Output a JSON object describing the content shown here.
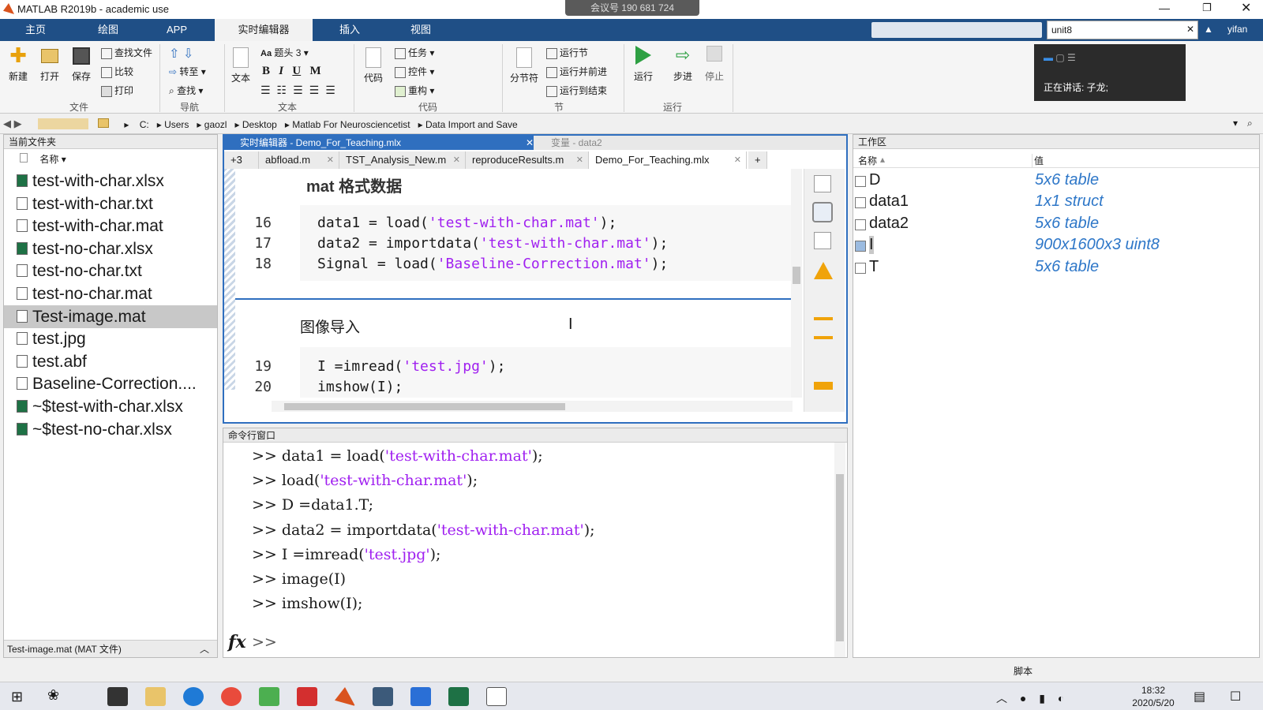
{
  "window": {
    "title": "MATLAB R2019b - academic use"
  },
  "meeting": {
    "label": "会议号 190 681 724"
  },
  "speaking": {
    "label": "正在讲话: 子龙;"
  },
  "ribbon_tabs": [
    "主页",
    "绘图",
    "APP",
    "实时编辑器",
    "插入",
    "视图"
  ],
  "search": {
    "value": "unit8"
  },
  "user": {
    "name": "yifan"
  },
  "ribbon": {
    "new": "新建",
    "open": "打开",
    "save": "保存",
    "find_files": "查找文件",
    "compare": "比较",
    "print": "打印",
    "goto": "转至",
    "find": "查找",
    "text_btn": "文本",
    "heading": "题头 3",
    "code_btn": "代码",
    "task": "任务",
    "control": "控件",
    "refactor": "重构",
    "section_break": "分节符",
    "run_section": "运行节",
    "run_advance": "运行并前进",
    "run_to_end": "运行到结束",
    "run": "运行",
    "step": "步进",
    "stop": "停止",
    "groups": {
      "file": "文件",
      "nav": "导航",
      "text": "文本",
      "code": "代码",
      "section": "节",
      "run": "运行"
    }
  },
  "address": [
    "C:",
    "Users",
    "gaozl",
    "Desktop",
    "Matlab For Neurosciencetist",
    "Data Import and Save"
  ],
  "file_panel": {
    "title": "当前文件夹",
    "column": "名称",
    "items": [
      "test-with-char.xlsx",
      "test-with-char.txt",
      "test-with-char.mat",
      "test-no-char.xlsx",
      "test-no-char.txt",
      "test-no-char.mat",
      "Test-image.mat",
      "test.jpg",
      "test.abf",
      "Baseline-Correction....",
      "~$test-with-char.xlsx",
      "~$test-no-char.xlsx"
    ],
    "selected_index": 6,
    "footer": "Test-image.mat  (MAT 文件)"
  },
  "editor": {
    "title": "实时编辑器 - Demo_For_Teaching.mlx",
    "var_title": "变量 - data2",
    "tabs": [
      "+3",
      "abfload.m",
      "TST_Analysis_New.m",
      "reproduceResults.m",
      "Demo_For_Teaching.mlx"
    ],
    "heading": "mat 格式数据",
    "section2": "图像导入",
    "lines": [
      {
        "n": "16",
        "a": "data1 = load(",
        "s": "'test-with-char.mat'",
        "b": ");"
      },
      {
        "n": "17",
        "a": "data2 = importdata(",
        "s": "'test-with-char.mat'",
        "b": ");"
      },
      {
        "n": "18",
        "a": "Signal = load(",
        "s": "'Baseline-Correction.mat'",
        "b": ");"
      },
      {
        "n": "19",
        "a": "I =imread(",
        "s": "'test.jpg'",
        "b": ");"
      },
      {
        "n": "20",
        "a": "imshow(I);",
        "s": "",
        "b": ""
      }
    ]
  },
  "cmd": {
    "title": "命令行窗口",
    "lines": [
      {
        "a": ">> data1 = load(",
        "s": "'test-with-char.mat'",
        "b": ");"
      },
      {
        "a": ">> load(",
        "s": "'test-with-char.mat'",
        "b": ");"
      },
      {
        "a": ">> D =data1.T;",
        "s": "",
        "b": ""
      },
      {
        "a": ">> data2 = importdata(",
        "s": "'test-with-char.mat'",
        "b": ");"
      },
      {
        "a": ">> I =imread(",
        "s": "'test.jpg'",
        "b": ");"
      },
      {
        "a": ">> image(I)",
        "s": "",
        "b": ""
      },
      {
        "a": ">> imshow(I);",
        "s": "",
        "b": ""
      }
    ],
    "prompt": ">>"
  },
  "workspace": {
    "title": "工作区",
    "col_name": "名称",
    "col_value": "值",
    "vars": [
      {
        "name": "D",
        "value": "5x6 table"
      },
      {
        "name": "data1",
        "value": "1x1 struct"
      },
      {
        "name": "data2",
        "value": "5x6 table"
      },
      {
        "name": "I",
        "value": "900x1600x3 uint8"
      },
      {
        "name": "T",
        "value": "5x6 table"
      }
    ]
  },
  "status": {
    "label": "脚本"
  },
  "clock": {
    "time": "18:32",
    "date": "2020/5/20"
  }
}
